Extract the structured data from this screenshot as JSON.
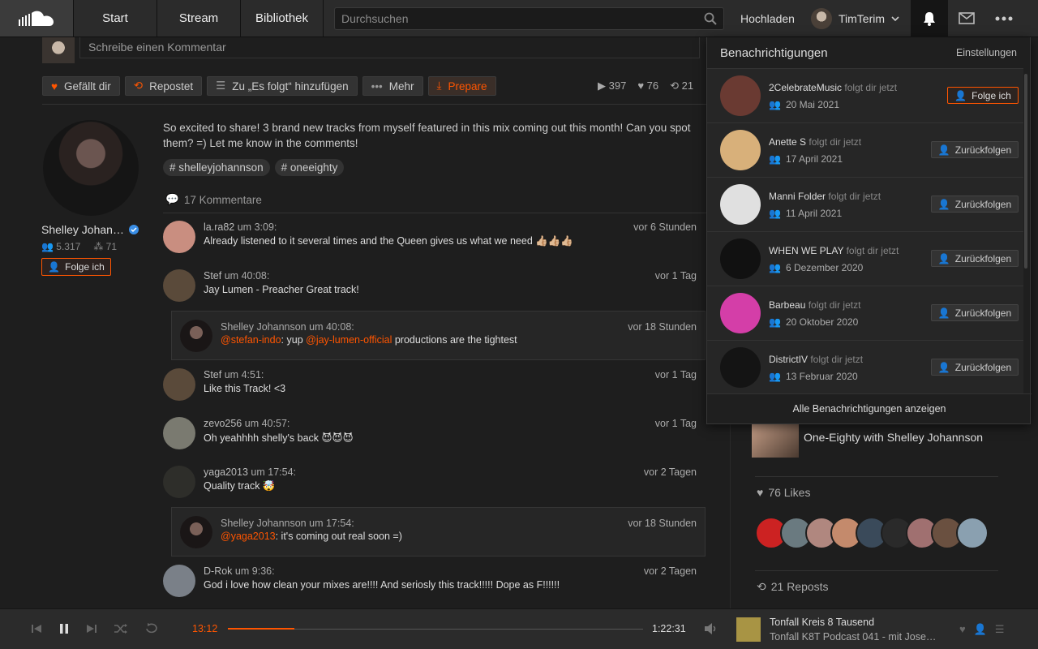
{
  "header": {
    "nav": [
      {
        "label": "Start"
      },
      {
        "label": "Stream"
      },
      {
        "label": "Bibliothek"
      }
    ],
    "search_placeholder": "Durchsuchen",
    "upload_label": "Hochladen",
    "username": "TimTerim"
  },
  "track": {
    "comment_placeholder": "Schreibe einen Kommentar",
    "actions": {
      "like": "Gefällt dir",
      "repost": "Repostet",
      "add": "Zu „Es folgt“ hinzufügen",
      "more": "Mehr",
      "prepare": "Prepare"
    },
    "stats": {
      "plays": "397",
      "likes": "76",
      "reposts": "21"
    },
    "description": "So excited to share! 3 brand new tracks from myself featured in this mix coming out this month! Can you spot them? =) Let me know in the comments!",
    "tags": [
      "# shelleyjohannson",
      "# oneeighty"
    ],
    "comment_count": "17 Kommentare"
  },
  "artist": {
    "name": "Shelley Johan…",
    "followers": "5.317",
    "tracks": "71",
    "follow_label": "Folge ich"
  },
  "comments": [
    {
      "user": "la.ra82",
      "at": "um",
      "time": "3:09:",
      "text": "Already listened to it several times and the Queen gives us what we need 👍🏼👍🏼👍🏼",
      "ago": "vor 6 Stunden",
      "color": "#c98e80"
    },
    {
      "user": "Stef",
      "at": "um",
      "time": "40:08:",
      "text": "Jay Lumen - Preacher Great track!",
      "ago": "vor 1 Tag",
      "color": "#5a4a3a"
    },
    {
      "user": "Stef",
      "at": "um",
      "time": "4:51:",
      "text": "Like this Track! <3",
      "ago": "vor 1 Tag",
      "color": "#5a4a3a"
    },
    {
      "user": "zevo256",
      "at": "um",
      "time": "40:57:",
      "text": "Oh yeahhhh shelly's back 😈😈😈",
      "ago": "vor 1 Tag",
      "color": "#7a7a70"
    },
    {
      "user": "yaga2013",
      "at": "um",
      "time": "17:54:",
      "text": "Quality track 🤯",
      "ago": "vor 2 Tagen",
      "color": "#2e2e2a"
    },
    {
      "user": "D-Rok",
      "at": "um",
      "time": "9:36:",
      "text": "God i love how clean your mixes are!!!! And seriosly this track!!!!! Dope as F!!!!!!",
      "ago": "vor 2 Tagen",
      "color": "#7a8088"
    }
  ],
  "replies": [
    {
      "user": "Shelley Johannson",
      "at": "um",
      "time": "40:08:",
      "mention1": "@stefan-indo",
      "mid": ": yup ",
      "mention2": "@jay-lumen-official",
      "rest": " productions are the tightest",
      "ago": "vor 18 Stunden"
    },
    {
      "user": "Shelley Johannson",
      "at": "um",
      "time": "17:54:",
      "mention1": "@yaga2013",
      "mid": ": it's coming out real soon =)",
      "mention2": "",
      "rest": "",
      "ago": "vor 18 Stunden"
    }
  ],
  "sidebar": {
    "playlist_title": "One-Eighty with Shelley Johannson",
    "likes_label": "76 Likes",
    "reposts_label": "21 Reposts",
    "liker_colors": [
      "#c22",
      "#6a7a80",
      "#b0877f",
      "#c48a6c",
      "#3a4a5a",
      "#2a2a2a",
      "#a07070",
      "#6a5040",
      "#8aa0b0"
    ]
  },
  "notifications": {
    "title": "Benachrichtigungen",
    "settings": "Einstellungen",
    "show_all": "Alle Benachrichtigungen anzeigen",
    "items": [
      {
        "name": "2CelebrateMusic",
        "action": "folgt dir jetzt",
        "date": "20 Mai 2021",
        "button": "Folge ich",
        "color": "#6a3a32"
      },
      {
        "name": "Anette S",
        "action": "folgt dir jetzt",
        "date": "17 April 2021",
        "button": "Zurückfolgen",
        "color": "#d8b07a"
      },
      {
        "name": "Manni Folder",
        "action": "folgt dir jetzt",
        "date": "11 April 2021",
        "button": "Zurückfolgen",
        "color": "#e0e0e0"
      },
      {
        "name": "WHEN WE PLAY",
        "action": "folgt dir jetzt",
        "date": "6 Dezember 2020",
        "button": "Zurückfolgen",
        "color": "#111"
      },
      {
        "name": "Barbeau",
        "action": "folgt dir jetzt",
        "date": "20 Oktober 2020",
        "button": "Zurückfolgen",
        "color": "#d43ea8"
      },
      {
        "name": "DistrictIV",
        "action": "folgt dir jetzt",
        "date": "13 Februar 2020",
        "button": "Zurückfolgen",
        "color": "#141414"
      }
    ]
  },
  "player": {
    "current": "13:12",
    "total": "1:22:31",
    "progress": 0.16,
    "artist": "Tonfall Kreis 8 Tausend",
    "title": "Tonfall K8T Podcast 041 - mit Jose…"
  },
  "colors": {
    "accent": "#ff5500",
    "bg": "#1e1e1e",
    "header": "#2b2b2b"
  }
}
